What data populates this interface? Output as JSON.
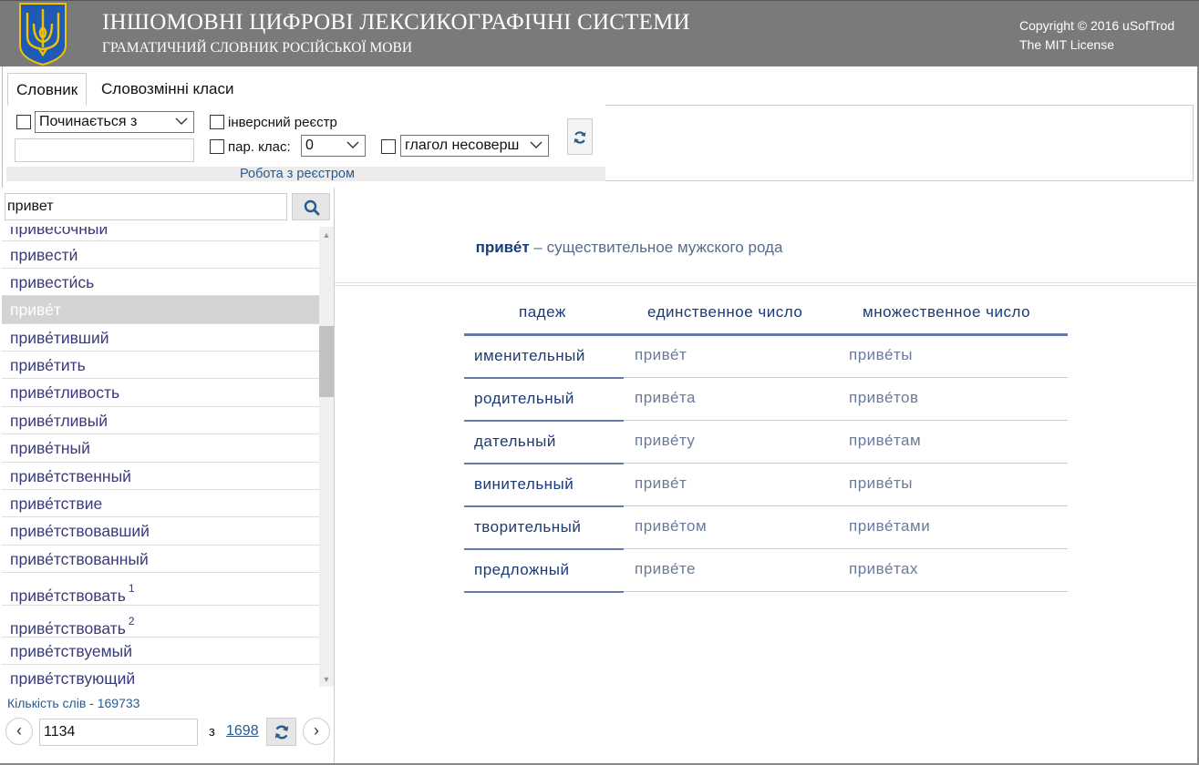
{
  "header": {
    "title": "ІНШОМОВНІ ЦИФРОВІ ЛЕКСИКОГРАФІЧНІ СИСТЕМИ",
    "subtitle": "ГРАМАТИЧНИЙ СЛОВНИК РОСІЙСЬКОЇ МОВИ",
    "copyright": "Copyright © 2016 uSofTrod",
    "license": "The MIT License",
    "emblem_icon": "trident-emblem-icon"
  },
  "tabs": [
    "Словник",
    "Словозмінні класи"
  ],
  "toolbar": {
    "match_mode": "Починається з",
    "inverse_label": "інверсний реєстр",
    "par_class_label": "пар. клас:",
    "par_class_value": "0",
    "pos_value": "глагол несоверш",
    "group_caption": "Робота з реєстром"
  },
  "search": {
    "value": "привет",
    "icon": "search-icon"
  },
  "wordlist": [
    {
      "text": "привесочный",
      "sup": ""
    },
    {
      "text": "привести́",
      "sup": ""
    },
    {
      "text": "привести́сь",
      "sup": ""
    },
    {
      "text": "приве́т",
      "sup": ""
    },
    {
      "text": "приве́тивший",
      "sup": ""
    },
    {
      "text": "приве́тить",
      "sup": ""
    },
    {
      "text": "приве́тливость",
      "sup": ""
    },
    {
      "text": "приве́тливый",
      "sup": ""
    },
    {
      "text": "приве́тный",
      "sup": ""
    },
    {
      "text": "приве́тственный",
      "sup": ""
    },
    {
      "text": "приве́тствие",
      "sup": ""
    },
    {
      "text": "приве́тствовавший",
      "sup": ""
    },
    {
      "text": "приве́тствованный",
      "sup": ""
    },
    {
      "text": "приве́тствовать",
      "sup": "1"
    },
    {
      "text": "приве́тствовать",
      "sup": "2"
    },
    {
      "text": "приве́тствуемый",
      "sup": ""
    },
    {
      "text": "приве́тствующий",
      "sup": ""
    }
  ],
  "selected_index": 3,
  "footer": {
    "count": "Кількість слів - 169733",
    "page": "1134",
    "of": "з",
    "total_pages": "1698",
    "prev": "‹",
    "next": "›"
  },
  "entry": {
    "word": "приве́т",
    "dash": " – ",
    "description": "существительное мужского рода"
  },
  "table": {
    "headers": [
      "падеж",
      "единственное число",
      "множественное число"
    ],
    "rows": [
      {
        "case": "именительный",
        "singular": "приве́т",
        "plural": "приве́ты"
      },
      {
        "case": "родительный",
        "singular": "приве́та",
        "plural": "приве́тов"
      },
      {
        "case": "дательный",
        "singular": "приве́ту",
        "plural": "приве́там"
      },
      {
        "case": "винительный",
        "singular": "приве́т",
        "plural": "приве́ты"
      },
      {
        "case": "творительный",
        "singular": "приве́том",
        "plural": "приве́тами"
      },
      {
        "case": "предложный",
        "singular": "приве́те",
        "plural": "приве́тах"
      }
    ]
  },
  "colors": {
    "header_bg": "#7a7a7a",
    "accent_blue": "#1a3a7a",
    "table_line": "#6878a8",
    "selected_row": "#d3d3d3"
  }
}
